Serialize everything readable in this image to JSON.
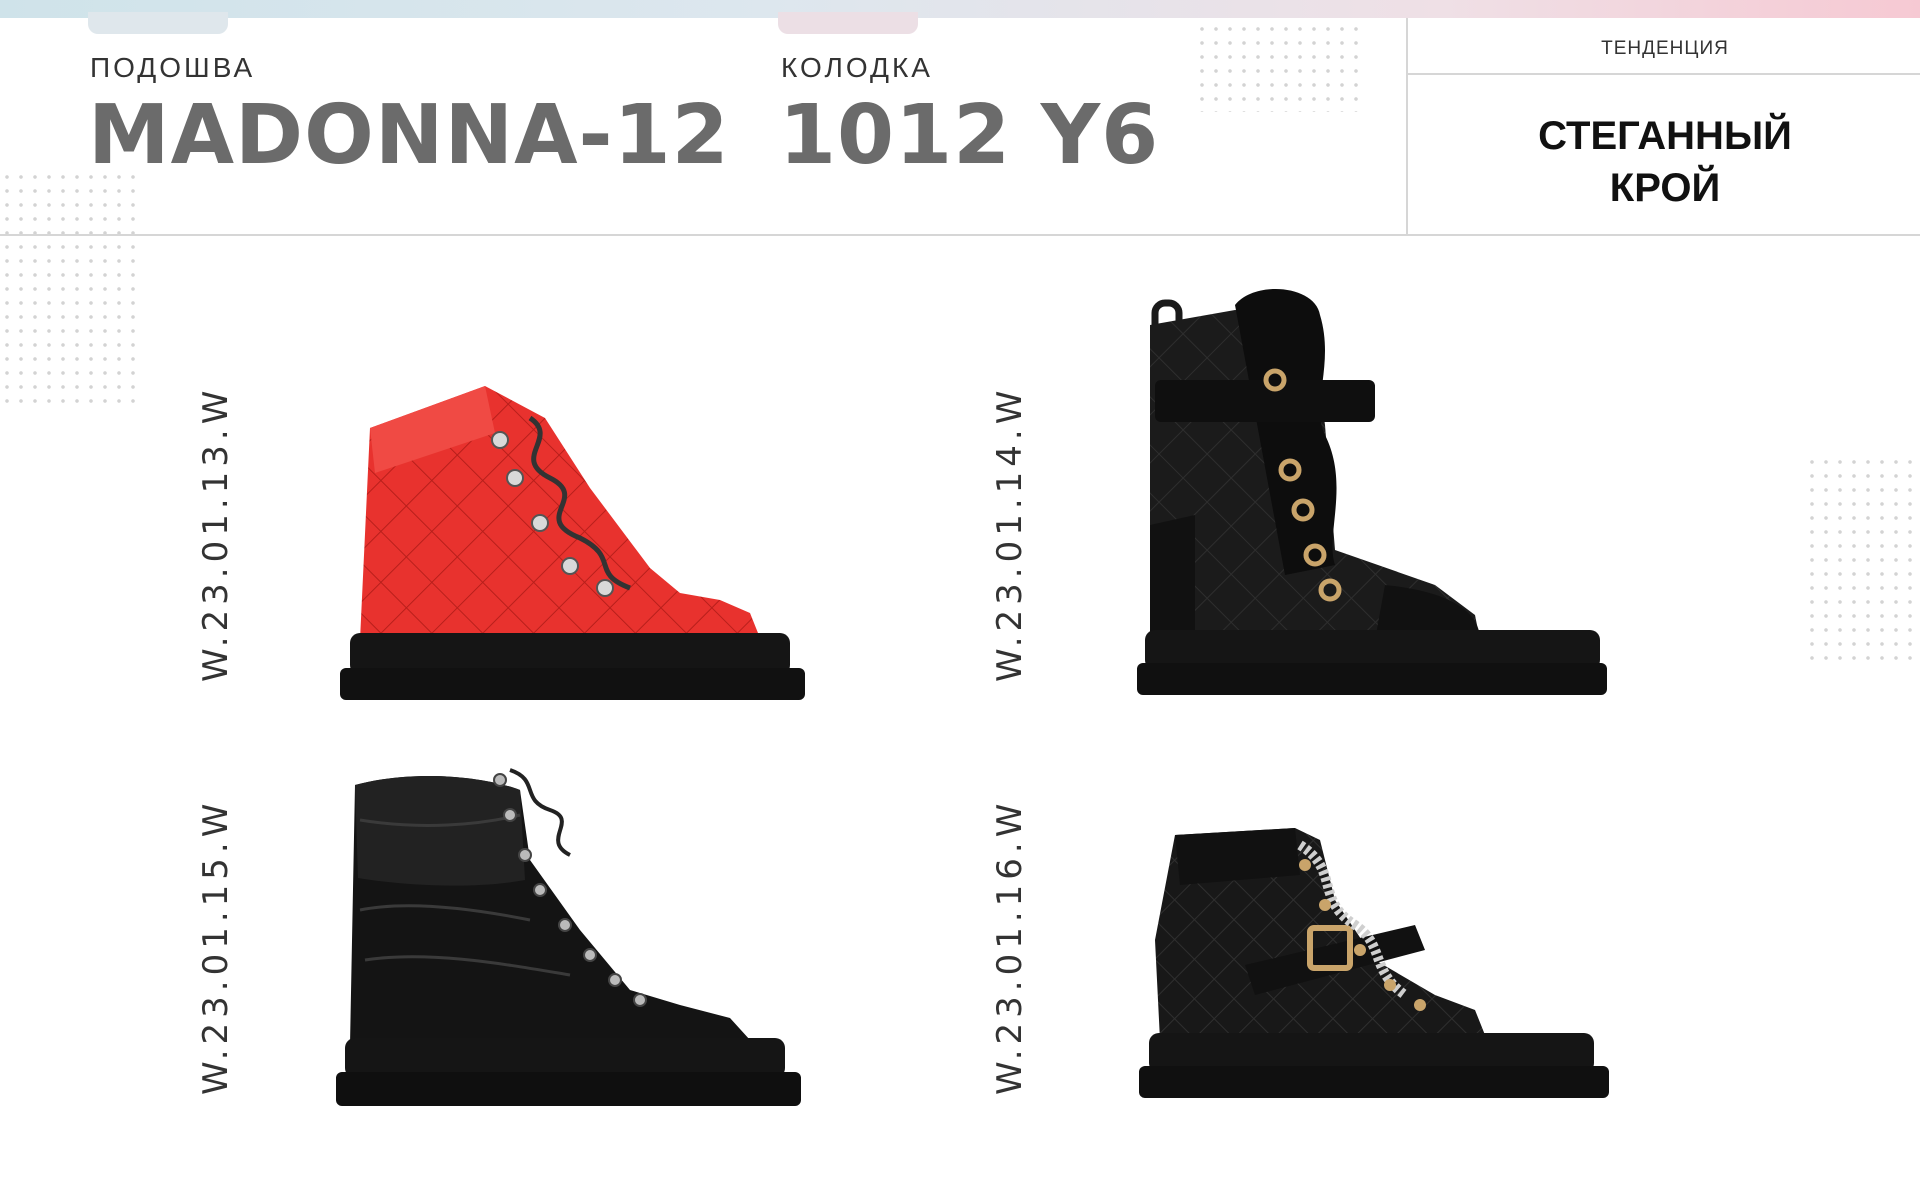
{
  "sole": {
    "label": "ПОДОШВА",
    "value": "MADONNA-12"
  },
  "last": {
    "label": "КОЛОДКА",
    "value": "1012 Y6"
  },
  "trend": {
    "label": "ТЕНДЕНЦИЯ",
    "value_line1": "СТЕГАННЫЙ",
    "value_line2": "КРОЙ"
  },
  "products": [
    {
      "code": "W.23.01.13.W",
      "color": "red",
      "icon": "red-quilted-hiking-boot"
    },
    {
      "code": "W.23.01.14.W",
      "color": "black",
      "icon": "black-quilted-fur-boot"
    },
    {
      "code": "W.23.01.15.W",
      "color": "black",
      "icon": "black-puffer-lace-boot"
    },
    {
      "code": "W.23.01.16.W",
      "color": "black",
      "icon": "black-quilted-buckle-boot"
    }
  ],
  "colors": {
    "accent_red": "#e8322e",
    "boot_black": "#151515",
    "title_gray": "#6b6b6b",
    "line_gray": "#d6d6d6"
  }
}
